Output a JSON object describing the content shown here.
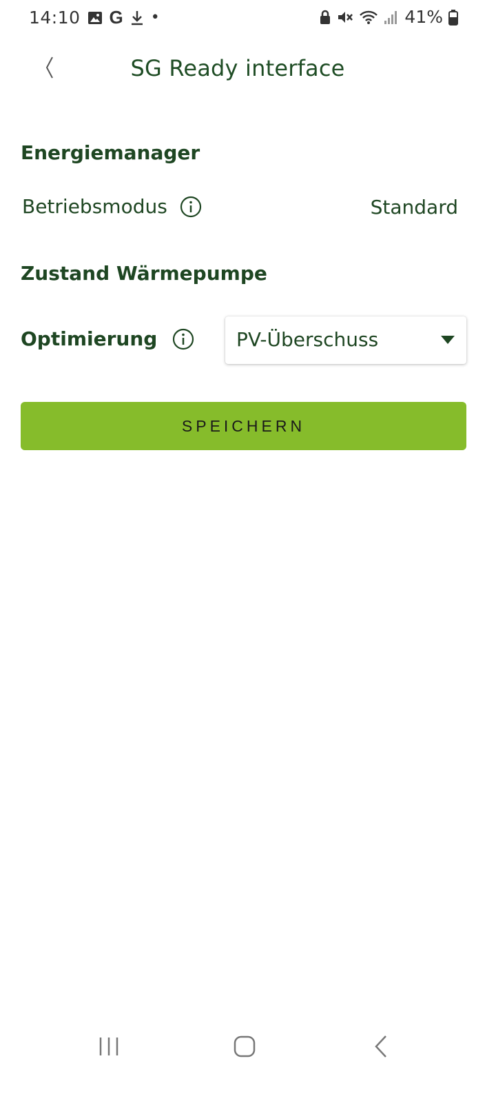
{
  "status_bar": {
    "time": "14:10",
    "left_icons": [
      "gallery-icon",
      "google-icon",
      "download-icon",
      "dot-icon"
    ],
    "google_glyph": "G",
    "dot_glyph": "•",
    "right_icons": [
      "lock-icon",
      "mute-icon",
      "wifi-icon",
      "signal-icon",
      "battery-icon"
    ],
    "battery_percent": "41%"
  },
  "header": {
    "back_icon": "chevron-left-icon",
    "title": "SG Ready interface"
  },
  "energy_manager": {
    "heading": "Energiemanager",
    "operating_mode_label": "Betriebsmodus",
    "operating_mode_value": "Standard"
  },
  "heat_pump": {
    "heading": "Zustand Wärmepumpe",
    "optimization_label": "Optimierung",
    "optimization_value": "PV-Überschuss"
  },
  "actions": {
    "save_label": "SPEICHERN"
  },
  "nav_bar": {
    "buttons": [
      "recent-apps-icon",
      "home-icon",
      "back-icon"
    ]
  },
  "colors": {
    "primary_text": "#1e4622",
    "accent_button": "#86bc2b"
  }
}
